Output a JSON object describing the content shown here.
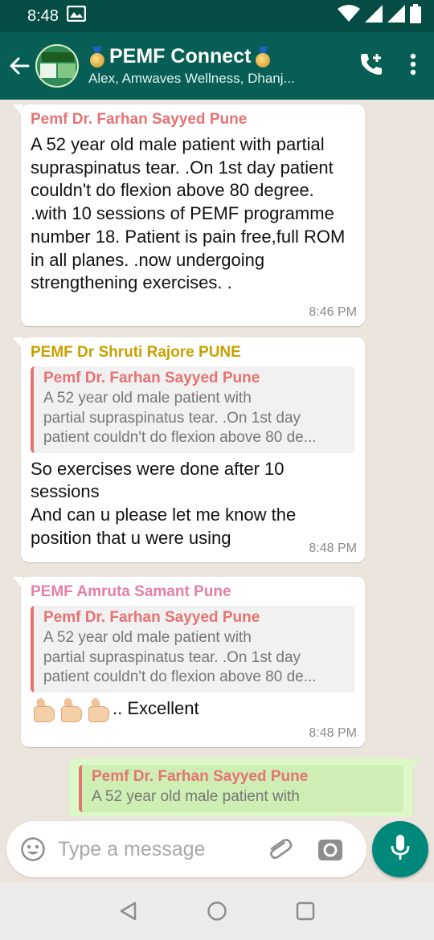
{
  "status_bar": {
    "time": "8:48",
    "icons": [
      "gallery-icon",
      "wifi-icon",
      "signal-icon",
      "signal-icon",
      "battery-icon"
    ]
  },
  "header": {
    "title": "PEMF Connect",
    "subtitle": "Alex, Amwaves Wellness, Dhanj...",
    "icons": [
      "back-arrow-icon",
      "add-call-icon",
      "more-options-icon"
    ]
  },
  "messages": [
    {
      "sender": "Pemf Dr. Farhan Sayyed Pune",
      "sender_color": "#e57373",
      "text": "A 52 year old male patient with partial supraspinatus tear. .On 1st day patient couldn't do flexion above 80 degree. .with 10 sessions of  PEMF programme number 18. Patient is pain free,full ROM in all planes. .now undergoing strengthening exercises. .",
      "time": "8:46 PM"
    },
    {
      "sender": "PEMF Dr Shruti Rajore PUNE",
      "sender_color": "#c9a000",
      "quote_name": "Pemf Dr. Farhan Sayyed Pune",
      "quote_lines": [
        "A 52 year old male patient with",
        "partial supraspinatus tear. .On 1st day",
        "patient couldn't do flexion above 80 de..."
      ],
      "text_lines": [
        "So exercises were done after 10",
        "sessions",
        "And can u please let me know the",
        "position that u were using"
      ],
      "time": "8:48 PM"
    },
    {
      "sender": "PEMF Amruta Samant Pune",
      "sender_color": "#e57fa7",
      "quote_name": "Pemf Dr. Farhan Sayyed Pune",
      "quote_lines": [
        "A 52 year old male patient with",
        "partial supraspinatus tear. .On 1st day",
        "patient couldn't do flexion above 80 de..."
      ],
      "text": ".. Excellent",
      "time": "8:48 PM"
    },
    {
      "quote_name": "Pemf Dr. Farhan Sayyed Pune",
      "quote_line": "A 52 year old male patient with"
    }
  ],
  "input": {
    "placeholder": "Type a message",
    "icons": [
      "emoji-icon",
      "attach-icon",
      "camera-icon",
      "mic-icon"
    ]
  },
  "navbar": {
    "icons": [
      "back-triangle-icon",
      "home-circle-icon",
      "recents-square-icon"
    ]
  }
}
